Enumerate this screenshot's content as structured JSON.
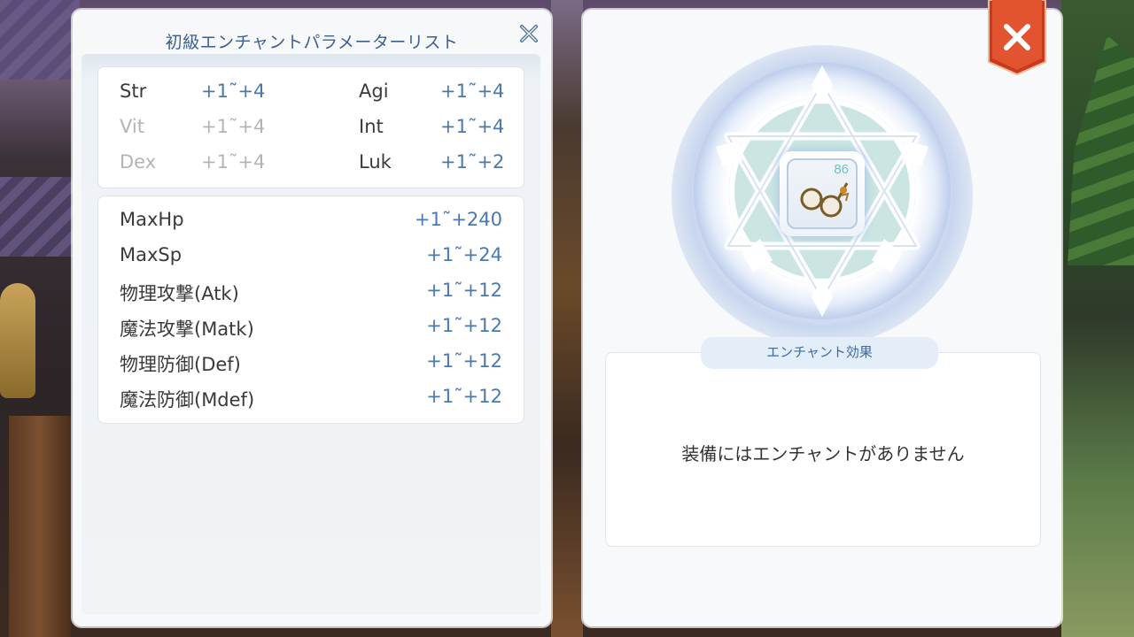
{
  "left_panel": {
    "title": "初級エンチャントパラメーターリスト",
    "stats": [
      {
        "name": "Str",
        "value": "+1˜+4",
        "dim": false
      },
      {
        "name": "Vit",
        "value": "+1˜+4",
        "dim": true
      },
      {
        "name": "Dex",
        "value": "+1˜+4",
        "dim": true
      },
      {
        "name": "Agi",
        "value": "+1˜+4",
        "dim": false
      },
      {
        "name": "Int",
        "value": "+1˜+4",
        "dim": false
      },
      {
        "name": "Luk",
        "value": "+1˜+2",
        "dim": false
      }
    ],
    "attributes": [
      {
        "name": "MaxHp",
        "value": "+1˜+240"
      },
      {
        "name": "MaxSp",
        "value": "+1˜+24"
      },
      {
        "name": "物理攻撃(Atk)",
        "value": "+1˜+12"
      },
      {
        "name": "魔法攻撃(Matk)",
        "value": "+1˜+12"
      },
      {
        "name": "物理防御(Def)",
        "value": "+1˜+12"
      },
      {
        "name": "魔法防御(Mdef)",
        "value": "+1˜+12"
      }
    ]
  },
  "right_panel": {
    "item": {
      "level": "86",
      "icon": "glasses-icon"
    },
    "effect_tab_label": "エンチャント効果",
    "effect_text": "装備にはエンチャントがありません"
  },
  "icons": {
    "close_small": "close-x-icon",
    "close_big": "close-x-icon"
  },
  "colors": {
    "accent_blue": "#4a78b0",
    "title_blue": "#3d5f8e",
    "close_red": "#d9462a"
  }
}
